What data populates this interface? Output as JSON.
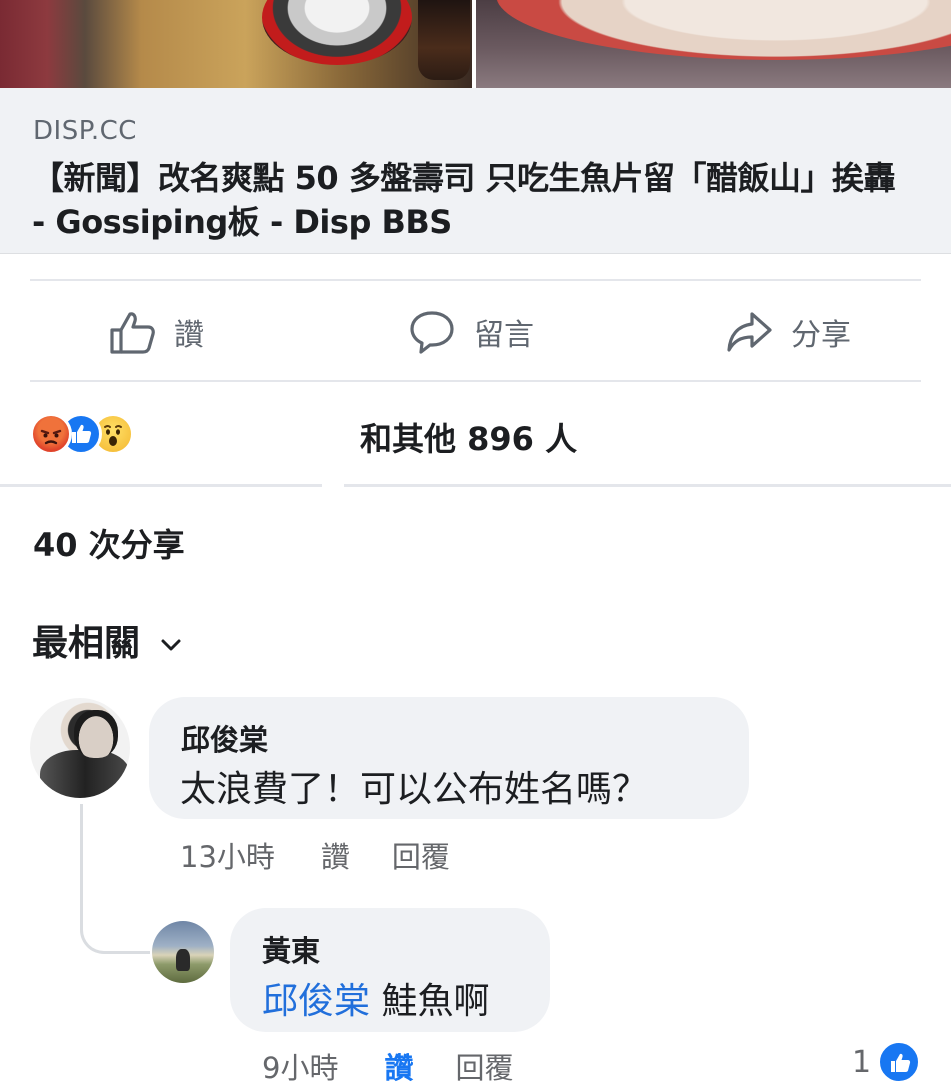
{
  "link_preview": {
    "domain": "DISP.CC",
    "title": "【新聞】改名爽點 50 多盤壽司 只吃生魚片留「醋飯山」挨轟 - Gossiping板 - Disp BBS"
  },
  "actions": {
    "like_label": "讚",
    "comment_label": "留言",
    "share_label": "分享"
  },
  "reactions": {
    "icons": [
      "angry-reaction-icon",
      "like-reaction-icon",
      "wow-reaction-icon"
    ],
    "others_text": "和其他 896 人"
  },
  "shares_text": "40 次分享",
  "sort": {
    "label": "最相關",
    "icon": "chevron-down-icon"
  },
  "comments": [
    {
      "author": "邱俊棠",
      "text": "太浪費了！可以公布姓名嗎？",
      "time": "13小時",
      "like_label": "讚",
      "reply_label": "回覆"
    }
  ],
  "replies": [
    {
      "author": "黃東",
      "mention": "邱俊棠",
      "text": "鮭魚啊",
      "time": "9小時",
      "like_label": "讚",
      "reply_label": "回覆",
      "like_count": "1"
    }
  ],
  "colors": {
    "link_blue": "#216fdb",
    "facebook_blue": "#1877f2",
    "meta_gray": "#65676b",
    "bubble_bg": "#f0f2f5"
  }
}
